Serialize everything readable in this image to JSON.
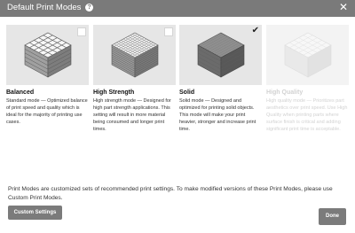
{
  "dialog": {
    "title": "Default Print Modes",
    "help_icon": "question-circle-icon",
    "close_icon": "close-x-icon",
    "close_glyph": "✕"
  },
  "modes": [
    {
      "name": "Balanced",
      "description": "Standard mode — Optimized balance of print speed and quality which is ideal for the majority of printing use cases.",
      "selected": false,
      "enabled": true
    },
    {
      "name": "High Strength",
      "description": "High strength mode — Designed for high part strength applications. This setting will result in more material being consumed and longer print times.",
      "selected": false,
      "enabled": true
    },
    {
      "name": "Solid",
      "description": "Solid mode — Designed and optimized for printing solid objects. This mode will make your print heavier, stronger and increase print time.",
      "selected": true,
      "enabled": true,
      "check_glyph": "✔"
    },
    {
      "name": "High Quality",
      "description": "High quality mode — Prioritizes part aesthetics over print speed. Use High Quality when printing parts where surface finish is critical and adding significant print time is acceptable.",
      "selected": false,
      "enabled": false
    }
  ],
  "footer": {
    "text": "Print Modes are customized sets of recommended print settings. To make modified versions of these Print Modes, please use Custom Print Modes.",
    "custom_button": "Custom Settings",
    "done_button": "Done"
  },
  "colors": {
    "titlebar": "#7a7a7a",
    "button": "#7b7b7b",
    "thumb_bg": "#e6e6e6"
  }
}
